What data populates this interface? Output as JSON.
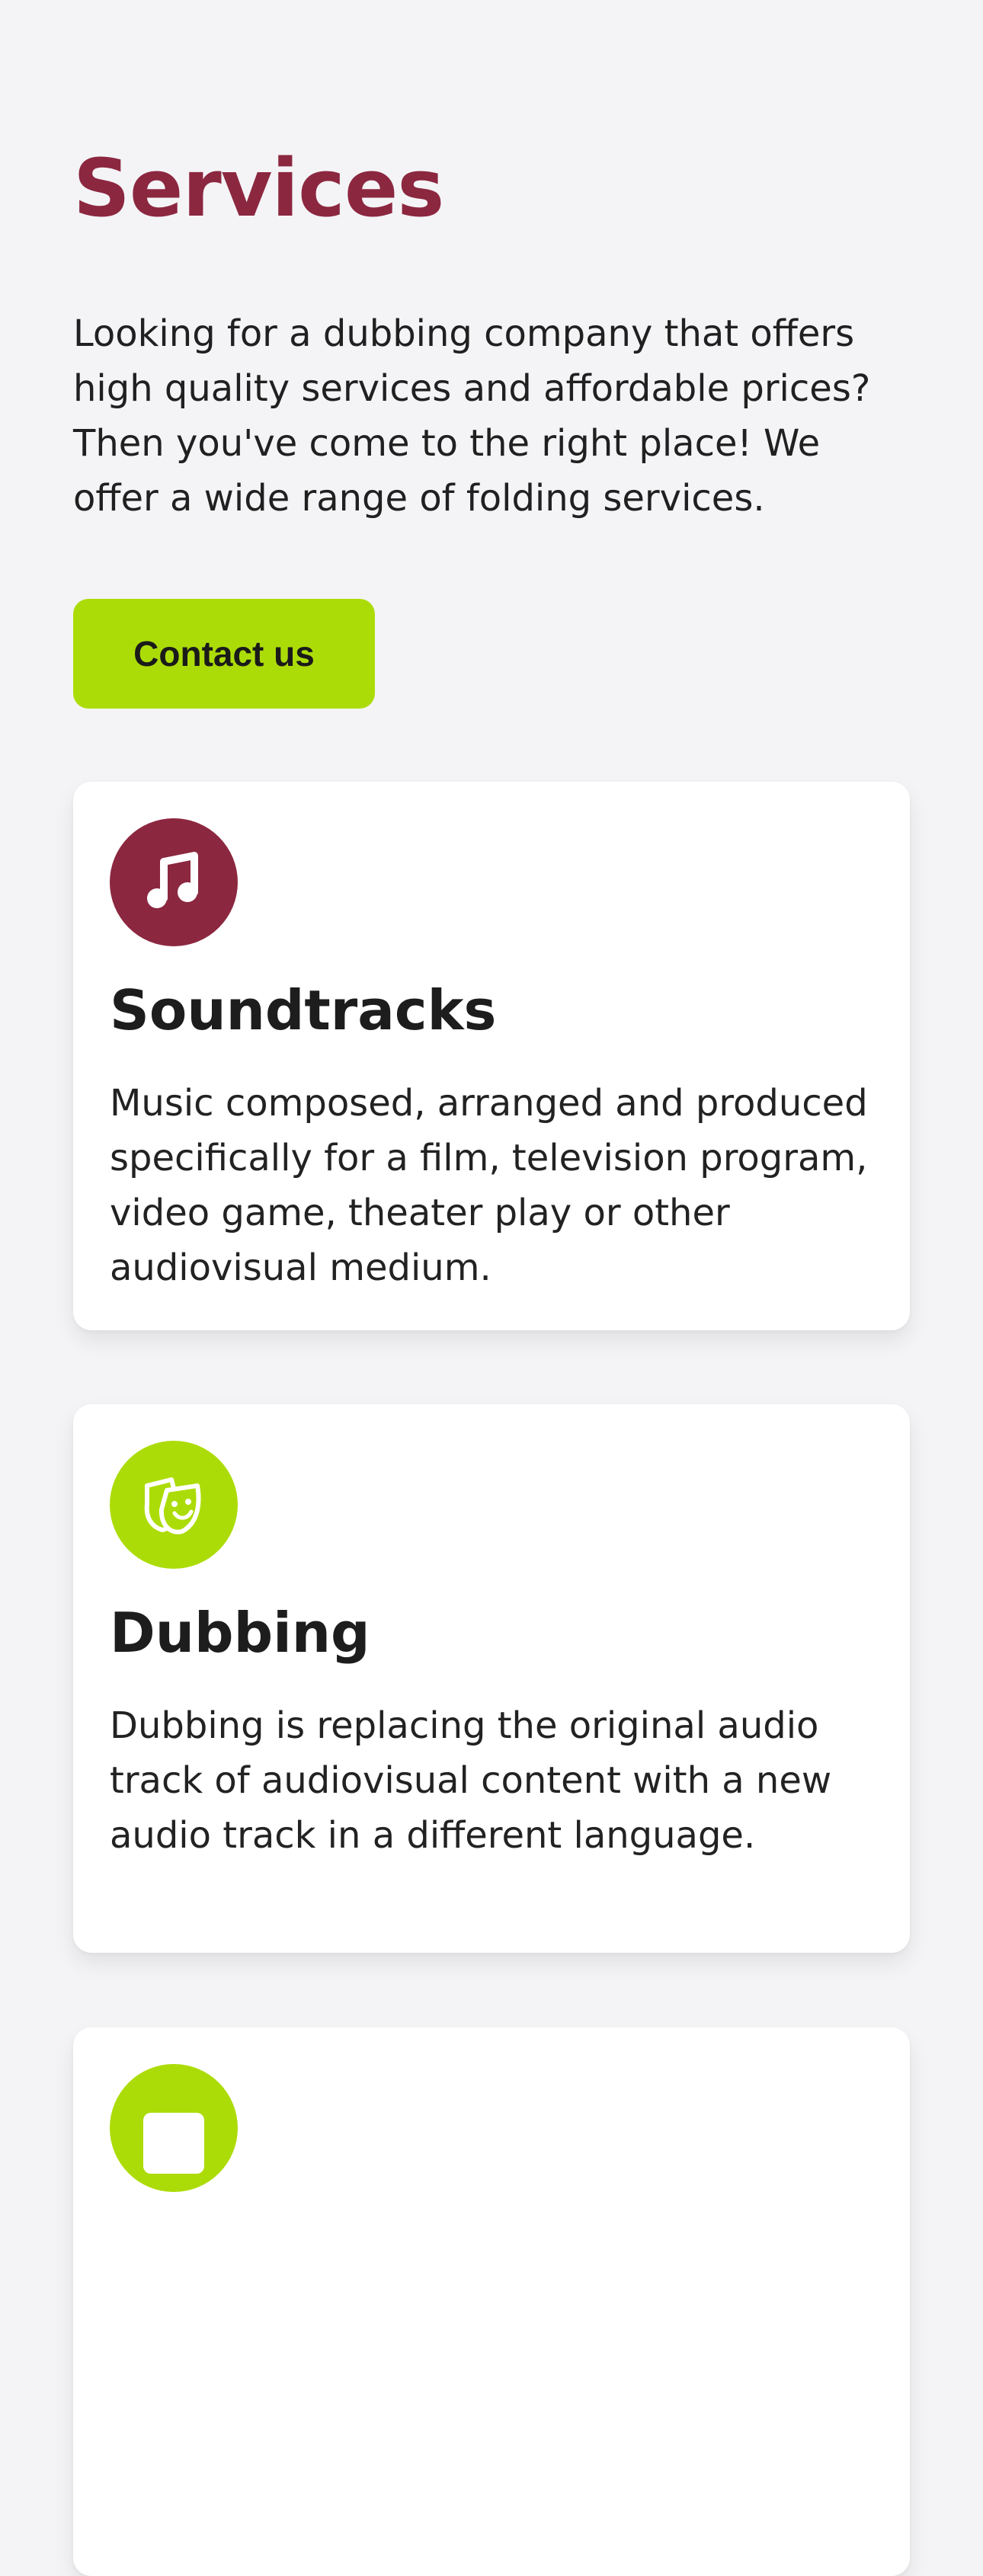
{
  "header": {
    "title": "Services",
    "intro": "Looking for a dubbing company that offers high quality services and affordable prices? Then you've come to the right place! We offer a wide range of folding services.",
    "cta_label": "Contact us"
  },
  "colors": {
    "brand_maroon": "#8c2740",
    "brand_lime": "#acdc08",
    "background": "#f4f4f6",
    "card_background": "#ffffff"
  },
  "services": [
    {
      "title": "Soundtracks",
      "description": "Music composed, arranged and produced specifically for a film, television program, video game, theater play or other audiovisual medium.",
      "icon": "music-note-icon"
    },
    {
      "title": "Dubbing",
      "description": "Dubbing is replacing the original audio track of audiovisual content with a new audio track in a different language.",
      "icon": "theater-masks-icon"
    },
    {
      "title": "",
      "description": "",
      "icon": "square-icon"
    }
  ]
}
